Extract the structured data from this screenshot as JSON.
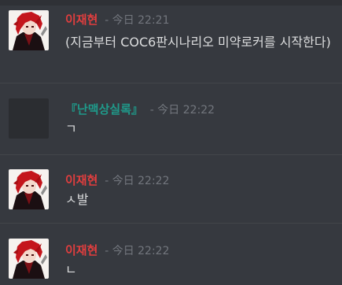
{
  "messages": [
    {
      "author": "이재현",
      "author_color": "#e23e3e",
      "timestamp": "- 今日 22:21",
      "content": "(지금부터 COC6판시나리오 미약로커를 시작한다)"
    },
    {
      "author": "『난맥상실록』",
      "author_color": "#1f9a8a",
      "timestamp": "- 今日 22:22",
      "content": "ㄱ"
    },
    {
      "author": "이재현",
      "author_color": "#e23e3e",
      "timestamp": "- 今日 22:22",
      "content": "ㅅ발"
    },
    {
      "author": "이재현",
      "author_color": "#e23e3e",
      "timestamp": "- 今日 22:22",
      "content": "ㄴ"
    }
  ]
}
